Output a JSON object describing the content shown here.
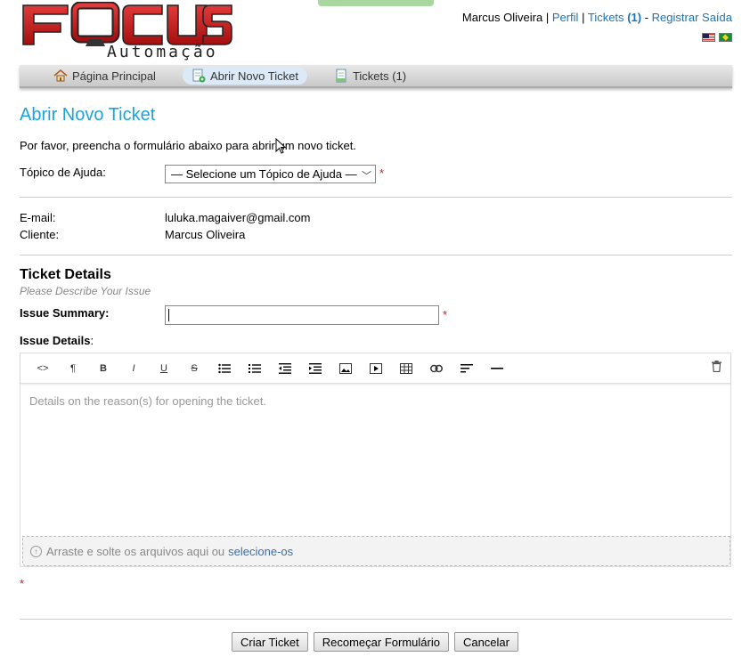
{
  "logo": {
    "name": "FOCUS",
    "sub": "Automação"
  },
  "userbar": {
    "user": "Marcus Oliveira",
    "profile": "Perfil",
    "tickets": "Tickets",
    "tickets_count": "(1)",
    "dash": "-",
    "logout": "Registrar Saída"
  },
  "nav": {
    "items": [
      {
        "label": "Página Principal",
        "icon": "home-icon"
      },
      {
        "label": "Abrir Novo Ticket",
        "icon": "new-ticket-icon"
      },
      {
        "label": "Tickets (1)",
        "icon": "tickets-icon"
      }
    ]
  },
  "page": {
    "title": "Abrir Novo Ticket",
    "intro": "Por favor, preencha o formulário abaixo para abrir um novo ticket."
  },
  "form": {
    "topic_label": "Tópico de Ajuda:",
    "topic_value": "— Selecione um Tópico de Ajuda —",
    "required_mark": "*",
    "email_label": "E-mail:",
    "email_value": "luluka.magaiver@gmail.com",
    "client_label": "Cliente:",
    "client_value": "Marcus Oliveira"
  },
  "details": {
    "title": "Ticket Details",
    "subtitle": "Please Describe Your Issue",
    "summary_label": "Issue Summary:",
    "summary_value": "",
    "details_label": "Issue Details",
    "details_colon": ":",
    "placeholder": "Details on the reason(s) for opening the ticket.",
    "drop_text": "Arraste e solte os arquivos aqui ou",
    "drop_link": "selecione-os"
  },
  "toolbar": [
    "code-icon",
    "paragraph-icon",
    "bold-icon",
    "italic-icon",
    "underline-icon",
    "strikethrough-icon",
    "bullet-list-icon",
    "numbered-list-icon",
    "outdent-icon",
    "indent-icon",
    "image-icon",
    "video-icon",
    "table-icon",
    "link-icon",
    "align-icon",
    "horizontal-rule-icon"
  ],
  "buttons": {
    "create": "Criar Ticket",
    "reset": "Recomeçar Formulário",
    "cancel": "Cancelar"
  }
}
